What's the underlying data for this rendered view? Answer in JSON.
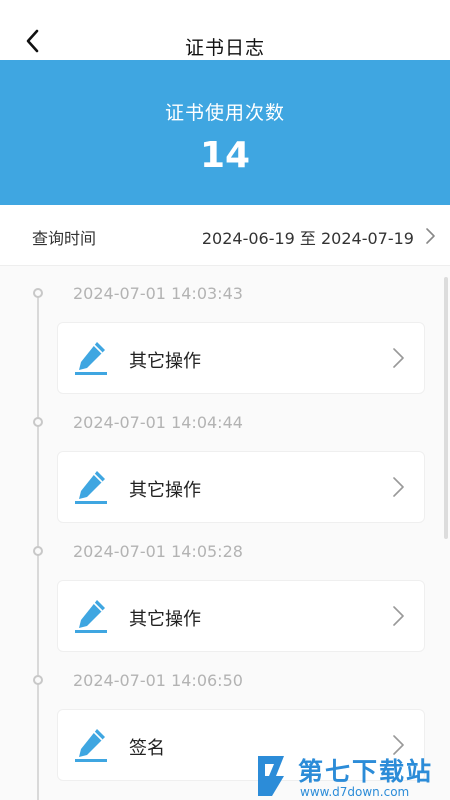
{
  "header": {
    "title": "证书日志",
    "back_icon": "chevron-left-icon"
  },
  "summary": {
    "label": "证书使用次数",
    "count": "14",
    "background_color": "#3fa6e1"
  },
  "query": {
    "label": "查询时间",
    "range": "2024-06-19 至 2024-07-19",
    "arrow_icon": "chevron-right-icon"
  },
  "logs": [
    {
      "time": "2024-07-01 14:03:43",
      "operation": "其它操作",
      "icon": "pen-icon"
    },
    {
      "time": "2024-07-01 14:04:44",
      "operation": "其它操作",
      "icon": "pen-icon"
    },
    {
      "time": "2024-07-01 14:05:28",
      "operation": "其它操作",
      "icon": "pen-icon"
    },
    {
      "time": "2024-07-01 14:06:50",
      "operation": "签名",
      "icon": "pen-icon"
    }
  ],
  "watermark": {
    "name": "第七下载站",
    "url": "www.d7down.com",
    "icon": "d7-logo-icon"
  },
  "colors": {
    "accent": "#3fa6e1",
    "timestamp": "#b3b3b3",
    "watermark": "#2c8cd8"
  }
}
